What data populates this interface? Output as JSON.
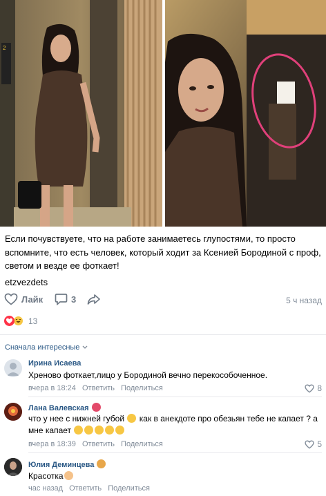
{
  "post": {
    "text": "Если почувствуете, что на работе занимаетесь глупостями, то просто вспомните, что есть человек, который ходит за Ксенией Бородиной с проф, светом и везде ее фоткает!",
    "hashtag": "etzvezdets",
    "like_label": "Лайк",
    "comments_count": "3",
    "time_ago": "5 ч назад",
    "reactions_count": "13"
  },
  "photos": [
    {
      "icon": "photo-woman-in-brown-dress-elevator"
    },
    {
      "icon": "photo-selfie-with-photographer-circled"
    }
  ],
  "comments_sort": "Сначала интересные",
  "comments": [
    {
      "name": "Ирина Исаева",
      "text": "Хреново фоткает,лицо у Бородиной вечно перекособоченное.",
      "time": "вчера в 18:24",
      "reply": "Ответить",
      "share": "Поделиться",
      "likes": "8"
    },
    {
      "name": "Лана Валевская",
      "text_line1": "что у нее с нижней губой",
      "text_line1b": "как в анекдоте про обезьян тебе не капает ? а",
      "text_line2": "мне капает",
      "time": "вчера в 18:39",
      "reply": "Ответить",
      "share": "Поделиться",
      "likes": "5"
    },
    {
      "name": "Юлия Деминцева",
      "text": "Красотка",
      "time": "час назад",
      "reply": "Ответить",
      "share": "Поделиться"
    }
  ],
  "colors": {
    "link": "#2a5885",
    "secondary": "#818c99",
    "icon": "#6f7985",
    "divider": "#e7e8ec",
    "photo_brown": "#4a3528"
  }
}
